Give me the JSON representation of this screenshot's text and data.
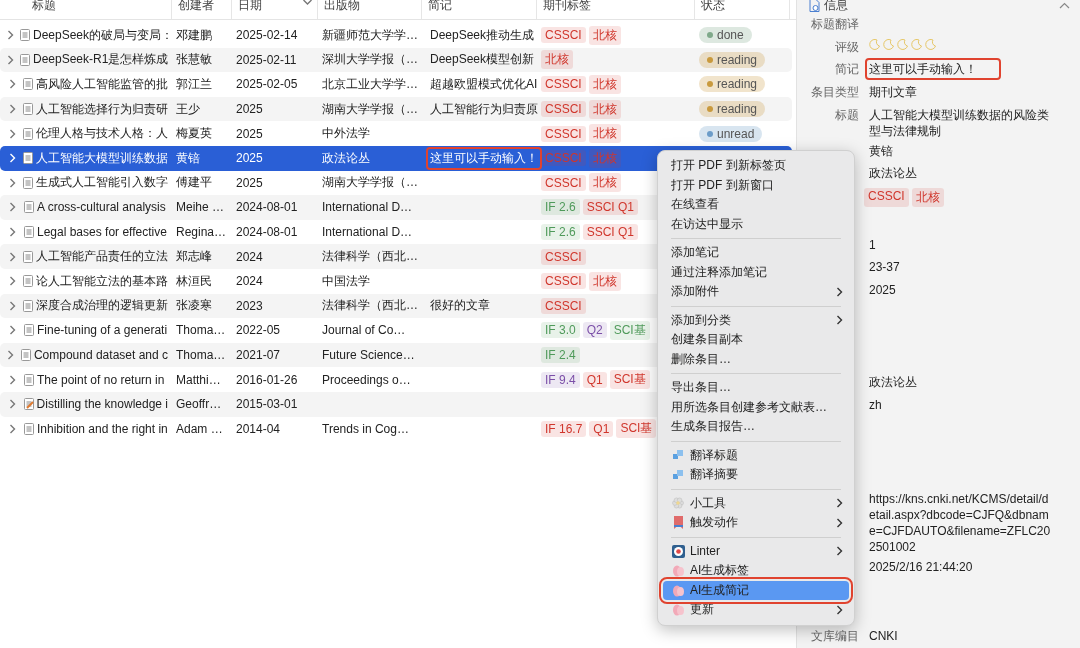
{
  "table": {
    "columns": [
      {
        "label": "标题",
        "sorted": false
      },
      {
        "label": "创建者",
        "sorted": false
      },
      {
        "label": "日期",
        "sorted": true
      },
      {
        "label": "出版物",
        "sorted": false
      },
      {
        "label": "简记",
        "sorted": false
      },
      {
        "label": "期刊标签",
        "sorted": false
      },
      {
        "label": "状态",
        "sorted": false
      }
    ],
    "rows": [
      {
        "kind": "article",
        "selected": false,
        "title": "DeepSeek的破局与变局：",
        "creator": "邓建鹏",
        "date": "2025-02-14",
        "publication": "新疆师范大学学…",
        "note": "DeepSeek推动生成",
        "tags": [
          {
            "label": "CSSCI",
            "color": "#d0362c"
          },
          {
            "label": "北核",
            "color": "#d0362c"
          }
        ],
        "status": {
          "label": "done",
          "color": "#7fa98a"
        }
      },
      {
        "kind": "article",
        "selected": false,
        "title": "DeepSeek-R1是怎样炼成",
        "creator": "张慧敏",
        "date": "2025-02-11",
        "publication": "深圳大学学报（…",
        "note": "DeepSeek模型创新",
        "tags": [
          {
            "label": "北核",
            "color": "#d0362c"
          }
        ],
        "status": {
          "label": "reading",
          "color": "#c99a3e"
        }
      },
      {
        "kind": "article",
        "selected": false,
        "title": "高风险人工智能监管的批",
        "creator": "郭江兰",
        "date": "2025-02-05",
        "publication": "北京工业大学学…",
        "note": "超越欧盟模式优化AI",
        "tags": [
          {
            "label": "CSSCI",
            "color": "#d0362c"
          },
          {
            "label": "北核",
            "color": "#d0362c"
          }
        ],
        "status": {
          "label": "reading",
          "color": "#c99a3e"
        }
      },
      {
        "kind": "article",
        "selected": false,
        "title": "人工智能选择行为归责研",
        "creator": "王少",
        "date": "2025",
        "publication": "湖南大学学报（…",
        "note": "人工智能行为归责原",
        "tags": [
          {
            "label": "CSSCI",
            "color": "#d0362c"
          },
          {
            "label": "北核",
            "color": "#d0362c"
          }
        ],
        "status": {
          "label": "reading",
          "color": "#c99a3e"
        }
      },
      {
        "kind": "article",
        "selected": false,
        "title": "伦理人格与技术人格：人",
        "creator": "梅夏英",
        "date": "2025",
        "publication": "中外法学",
        "tags": [
          {
            "label": "CSSCI",
            "color": "#d0362c"
          },
          {
            "label": "北核",
            "color": "#d0362c"
          }
        ],
        "status": {
          "label": "unread",
          "color": "#6c9cc8"
        }
      },
      {
        "kind": "article",
        "selected": true,
        "title": "人工智能大模型训练数据",
        "creator": "黄锫",
        "date": "2025",
        "publication": "政法论丛",
        "note": "这里可以手动输入！",
        "note_highlighted": true,
        "tags": [
          {
            "label": "CSSCI",
            "color": "#d0362c"
          },
          {
            "label": "北核",
            "color": "#d0362c"
          }
        ]
      },
      {
        "kind": "article",
        "selected": false,
        "title": "生成式人工智能引入数字",
        "creator": "傅建平",
        "date": "2025",
        "publication": "湖南大学学报（…",
        "tags": [
          {
            "label": "CSSCI",
            "color": "#d0362c"
          },
          {
            "label": "北核",
            "color": "#d0362c"
          }
        ]
      },
      {
        "kind": "article",
        "selected": false,
        "title": "A cross-cultural analysis",
        "creator": "Meihe …",
        "date": "2024-08-01",
        "publication": "International D…",
        "tags": [
          {
            "label": "IF 2.6",
            "color": "#4f9a5a"
          },
          {
            "label": "SSCI Q1",
            "color": "#d0362c"
          }
        ]
      },
      {
        "kind": "article",
        "selected": false,
        "title": "Legal bases for effective",
        "creator": "Regina…",
        "date": "2024-08-01",
        "publication": "International D…",
        "tags": [
          {
            "label": "IF 2.6",
            "color": "#4f9a5a"
          },
          {
            "label": "SSCI Q1",
            "color": "#d0362c"
          }
        ]
      },
      {
        "kind": "article",
        "selected": false,
        "title": "人工智能产品责任的立法",
        "creator": "郑志峰",
        "date": "2024",
        "publication": "法律科学（西北…",
        "tags": [
          {
            "label": "CSSCI",
            "color": "#d0362c"
          }
        ]
      },
      {
        "kind": "article",
        "selected": false,
        "title": "论人工智能立法的基本路",
        "creator": "林洹民",
        "date": "2024",
        "publication": "中国法学",
        "tags": [
          {
            "label": "CSSCI",
            "color": "#d0362c"
          },
          {
            "label": "北核",
            "color": "#d0362c"
          }
        ]
      },
      {
        "kind": "article",
        "selected": false,
        "title": "深度合成治理的逻辑更新",
        "creator": "张凌寒",
        "date": "2023",
        "publication": "法律科学（西北…",
        "note": "很好的文章",
        "tags": [
          {
            "label": "CSSCI",
            "color": "#d0362c"
          }
        ]
      },
      {
        "kind": "article",
        "selected": false,
        "title": "Fine-tuning of a generati",
        "creator": "Thoma…",
        "date": "2022-05",
        "publication": "Journal of Co…",
        "tags": [
          {
            "label": "IF 3.0",
            "color": "#4f9a5a"
          },
          {
            "label": "Q2",
            "color": "#7b4fa8"
          },
          {
            "label": "SCI基",
            "color": "#4f9a5a"
          }
        ]
      },
      {
        "kind": "article",
        "selected": false,
        "title": "Compound dataset and c",
        "creator": "Thoma…",
        "date": "2021-07",
        "publication": "Future Science…",
        "tags": [
          {
            "label": "IF 2.4",
            "color": "#4f9a5a"
          }
        ]
      },
      {
        "kind": "article",
        "selected": false,
        "title": "The point of no return in",
        "creator": "Matthi…",
        "date": "2016-01-26",
        "publication": "Proceedings o…",
        "tags": [
          {
            "label": "IF 9.4",
            "color": "#7b4fa8"
          },
          {
            "label": "Q1",
            "color": "#d0362c"
          },
          {
            "label": "SCI基",
            "color": "#d0362c"
          }
        ]
      },
      {
        "kind": "annotated",
        "selected": false,
        "title": "Distilling the knowledge i",
        "creator": "Geoffr…",
        "date": "2015-03-01"
      },
      {
        "kind": "article",
        "selected": false,
        "title": "Inhibition and the right in",
        "creator": "Adam …",
        "date": "2014-04",
        "publication": "Trends in Cog…",
        "tags": [
          {
            "label": "IF 16.7",
            "color": "#d0362c"
          },
          {
            "label": "Q1",
            "color": "#d0362c"
          },
          {
            "label": "SCI基",
            "color": "#d0362c"
          }
        ]
      }
    ]
  },
  "context_menu": {
    "groups": [
      [
        {
          "kind": "plain",
          "label": "打开 PDF 到新标签页",
          "submenu": false,
          "selected": false
        },
        {
          "kind": "plain",
          "label": "打开 PDF 到新窗口",
          "submenu": false,
          "selected": false
        },
        {
          "kind": "plain",
          "label": "在线查看",
          "submenu": false,
          "selected": false
        },
        {
          "kind": "plain",
          "label": "在访达中显示",
          "submenu": false,
          "selected": false
        }
      ],
      [
        {
          "kind": "plain",
          "label": "添加笔记",
          "submenu": false,
          "selected": false
        },
        {
          "kind": "plain",
          "label": "通过注释添加笔记",
          "submenu": false,
          "selected": false
        },
        {
          "kind": "plain",
          "label": "添加附件",
          "submenu": true,
          "selected": false
        }
      ],
      [
        {
          "kind": "plain",
          "label": "添加到分类",
          "submenu": true,
          "selected": false
        },
        {
          "kind": "plain",
          "label": "创建条目副本",
          "submenu": false,
          "selected": false
        },
        {
          "kind": "plain",
          "label": "删除条目…",
          "submenu": false,
          "selected": false
        }
      ],
      [
        {
          "kind": "plain",
          "label": "导出条目…",
          "submenu": false,
          "selected": false
        },
        {
          "kind": "plain",
          "label": "用所选条目创建参考文献表…",
          "submenu": false,
          "selected": false
        },
        {
          "kind": "plain",
          "label": "生成条目报告…",
          "submenu": false,
          "selected": false
        }
      ],
      [
        {
          "kind": "translate",
          "label": "翻译标题",
          "submenu": false,
          "selected": false
        },
        {
          "kind": "translate",
          "label": "翻译摘要",
          "submenu": false,
          "selected": false
        }
      ],
      [
        {
          "kind": "tool",
          "label": "小工具",
          "submenu": true,
          "selected": false
        },
        {
          "kind": "trigger",
          "label": "触发动作",
          "submenu": true,
          "selected": false
        }
      ],
      [
        {
          "kind": "linter",
          "label": "Linter",
          "submenu": true,
          "selected": false
        },
        {
          "kind": "ai",
          "label": "AI生成标签",
          "submenu": false,
          "selected": false
        },
        {
          "kind": "ai",
          "label": "AI生成简记",
          "submenu": false,
          "selected": true,
          "highlighted": true
        },
        {
          "kind": "ai",
          "label": "更新",
          "submenu": true,
          "selected": false
        }
      ]
    ]
  },
  "info_panel": {
    "title": "信息",
    "expanded": true,
    "sections": [
      [
        {
          "kind": "text",
          "label": "标题翻译"
        },
        {
          "kind": "stars",
          "label": "评级",
          "stars": 0
        },
        {
          "kind": "text",
          "label": "简记",
          "value": "这里可以手动输入！",
          "highlighted": true
        },
        {
          "kind": "text",
          "label": "条目类型",
          "value": "期刊文章"
        },
        {
          "kind": "text",
          "label": "标题",
          "value": "人工智能大模型训练数据的风险类型与法律规制"
        },
        {
          "kind": "text",
          "value": "黄锫"
        },
        {
          "kind": "text",
          "value": "政法论丛"
        },
        {
          "kind": "tags",
          "tags": [
            {
              "label": "CSSCI",
              "color": "#d0362c"
            },
            {
              "label": "北核",
              "color": "#d0362c"
            }
          ]
        }
      ],
      [
        {
          "kind": "text",
          "value": "1"
        },
        {
          "kind": "text",
          "value": "23-37"
        },
        {
          "kind": "text",
          "value": "2025"
        }
      ],
      [
        {
          "kind": "text",
          "value": "政法论丛"
        },
        {
          "kind": "text",
          "value": "zh"
        }
      ],
      [
        {
          "kind": "text",
          "value": "https://kns.cnki.net/KCMS/detail/detail.aspx?dbcode=CJFQ&dbname=CJFDAUTO&filename=ZFLC202501002"
        },
        {
          "kind": "text",
          "value": "2025/2/16 21:44:20"
        }
      ],
      [
        {
          "kind": "text",
          "label": "文库编目",
          "value": "CNKI"
        }
      ]
    ]
  }
}
